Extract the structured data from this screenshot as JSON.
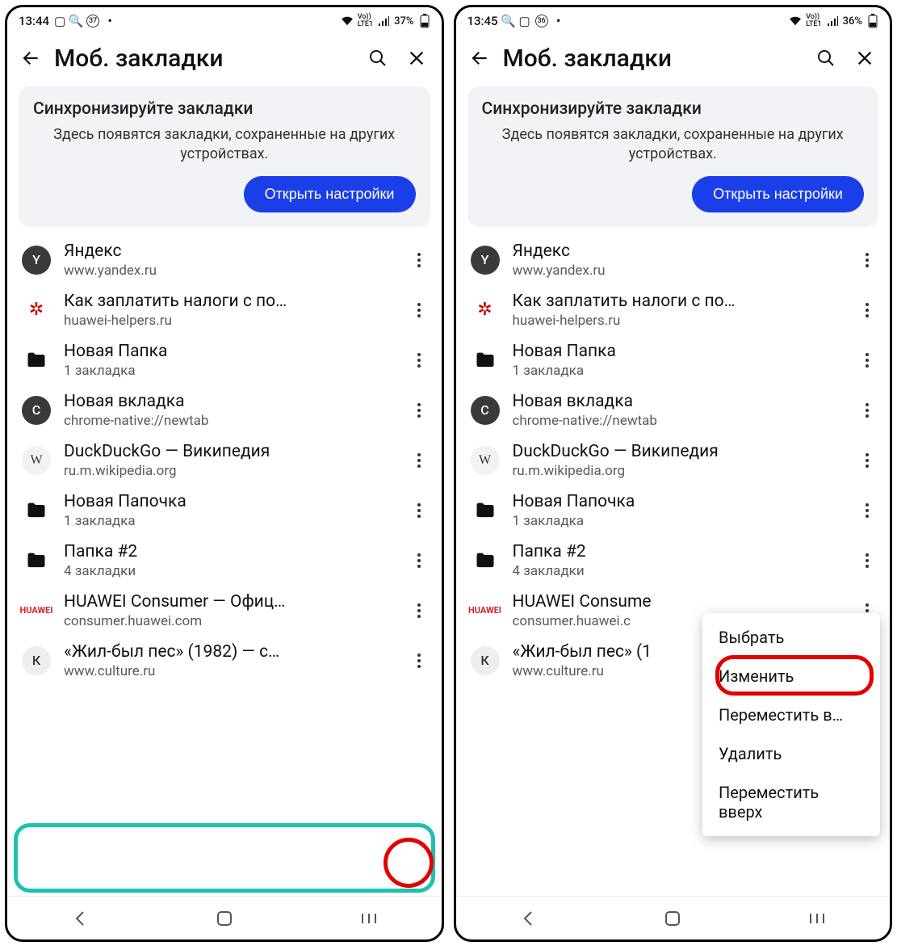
{
  "left": {
    "status": {
      "time": "13:44",
      "battery": "37%",
      "lte": "LTE1",
      "vo": "Vo))",
      "badge": "37"
    },
    "header": {
      "title": "Моб. закладки"
    },
    "sync": {
      "title": "Синхронизируйте закладки",
      "body": "Здесь появятся закладки, сохраненные на других устройствах.",
      "button": "Открыть настройки"
    },
    "items": [
      {
        "title": "Яндекс",
        "sub": "www.yandex.ru",
        "fav": "Y",
        "favClass": "fav-y"
      },
      {
        "title": "Как заплатить налоги с по…",
        "sub": "huawei-helpers.ru",
        "fav": "✲",
        "favClass": "fav-hw"
      },
      {
        "title": "Новая Папка",
        "sub": "1 закладка",
        "fav": "folder",
        "favClass": "fav-folder"
      },
      {
        "title": "Новая вкладка",
        "sub": "chrome-native://newtab",
        "fav": "C",
        "favClass": "fav-c"
      },
      {
        "title": "DuckDuckGo — Википедия",
        "sub": "ru.m.wikipedia.org",
        "fav": "W",
        "favClass": "fav-w"
      },
      {
        "title": "Новая Папочка",
        "sub": "1 закладка",
        "fav": "folder",
        "favClass": "fav-folder"
      },
      {
        "title": "Папка #2",
        "sub": "4 закладки",
        "fav": "folder",
        "favClass": "fav-folder"
      },
      {
        "title": "HUAWEI Consumer — Офиц…",
        "sub": "consumer.huawei.com",
        "fav": "HUAWEI",
        "favClass": "fav-huawei"
      },
      {
        "title": "«Жил-был пес» (1982) — с…",
        "sub": "www.culture.ru",
        "fav": "К",
        "favClass": "fav-k"
      }
    ]
  },
  "right": {
    "status": {
      "time": "13:45",
      "battery": "36%",
      "lte": "LTE1",
      "vo": "Vo))",
      "badge": "36"
    },
    "header": {
      "title": "Моб. закладки"
    },
    "sync": {
      "title": "Синхронизируйте закладки",
      "body": "Здесь появятся закладки, сохраненные на других устройствах.",
      "button": "Открыть настройки"
    },
    "items": [
      {
        "title": "Яндекс",
        "sub": "www.yandex.ru",
        "fav": "Y",
        "favClass": "fav-y"
      },
      {
        "title": "Как заплатить налоги с по…",
        "sub": "huawei-helpers.ru",
        "fav": "✲",
        "favClass": "fav-hw"
      },
      {
        "title": "Новая Папка",
        "sub": "1 закладка",
        "fav": "folder",
        "favClass": "fav-folder"
      },
      {
        "title": "Новая вкладка",
        "sub": "chrome-native://newtab",
        "fav": "C",
        "favClass": "fav-c"
      },
      {
        "title": "DuckDuckGo — Википедия",
        "sub": "ru.m.wikipedia.org",
        "fav": "W",
        "favClass": "fav-w"
      },
      {
        "title": "Новая Папочка",
        "sub": "1 закладка",
        "fav": "folder",
        "favClass": "fav-folder"
      },
      {
        "title": "Папка #2",
        "sub": "4 закладки",
        "fav": "folder",
        "favClass": "fav-folder"
      },
      {
        "title": "HUAWEI Consume",
        "sub": "consumer.huawei.c",
        "fav": "HUAWEI",
        "favClass": "fav-huawei"
      },
      {
        "title": "«Жил-был пес» (1",
        "sub": "www.culture.ru",
        "fav": "К",
        "favClass": "fav-k"
      }
    ],
    "menu": {
      "items": [
        "Выбрать",
        "Изменить",
        "Переместить в…",
        "Удалить",
        "Переместить вверх"
      ]
    }
  }
}
